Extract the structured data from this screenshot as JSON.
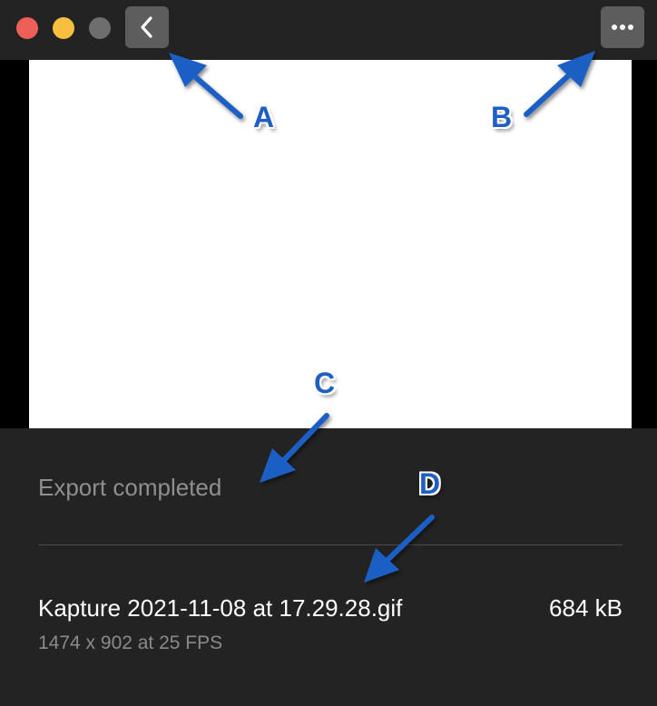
{
  "window": {
    "controls": [
      "close",
      "minimize",
      "zoom"
    ],
    "colors": {
      "close": "#ee5f57",
      "minimize": "#f6bf3f",
      "zoom": "#6e6e6e"
    }
  },
  "toolbar": {
    "back_icon": "chevron-left-icon",
    "more_icon": "more-horizontal-icon"
  },
  "export": {
    "status": "Export completed",
    "file_name": "Kapture 2021-11-08 at 17.29.28.gif",
    "file_size": "684 kB",
    "file_meta": "1474 x 902 at 25 FPS"
  },
  "annotations": {
    "labels": [
      "A",
      "B",
      "C",
      "D"
    ],
    "color": "#1f5fc4"
  }
}
